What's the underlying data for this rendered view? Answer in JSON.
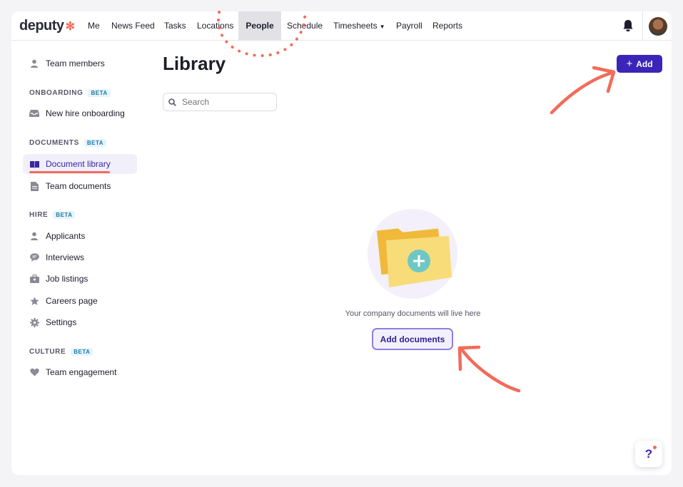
{
  "nav": {
    "logo": "deputy",
    "items": [
      {
        "label": "Me"
      },
      {
        "label": "News Feed"
      },
      {
        "label": "Tasks"
      },
      {
        "label": "Locations"
      },
      {
        "label": "People"
      },
      {
        "label": "Schedule"
      },
      {
        "label": "Timesheets"
      },
      {
        "label": "Payroll"
      },
      {
        "label": "Reports"
      }
    ],
    "active": "People"
  },
  "sidebar": {
    "team_members": "Team members",
    "onboarding_head": "ONBOARDING",
    "new_hire": "New hire onboarding",
    "documents_head": "DOCUMENTS",
    "document_library": "Document library",
    "team_documents": "Team documents",
    "hire_head": "HIRE",
    "applicants": "Applicants",
    "interviews": "Interviews",
    "job_listings": "Job listings",
    "careers_page": "Careers page",
    "settings": "Settings",
    "culture_head": "CULTURE",
    "team_engagement": "Team engagement",
    "beta": "BETA"
  },
  "main": {
    "title": "Library",
    "add_label": "Add",
    "search_placeholder": "Search",
    "empty_text": "Your company documents will live here",
    "add_documents": "Add documents"
  },
  "help": "?",
  "colors": {
    "brand": "#3a25b8",
    "annotation": "#f26b5b",
    "folder": "#f5c24b"
  }
}
